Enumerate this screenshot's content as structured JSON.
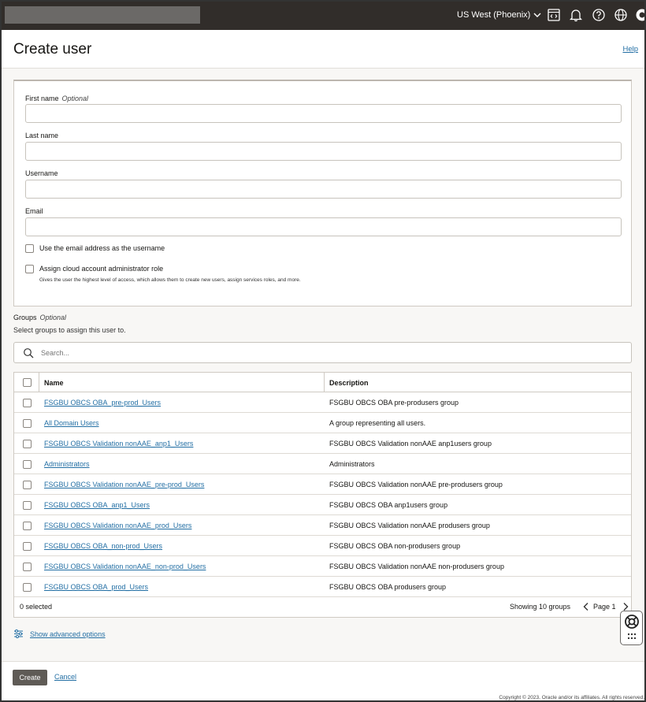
{
  "topbar": {
    "region": "US West (Phoenix)",
    "icons": [
      "code-editor-icon",
      "bell-icon",
      "help-icon",
      "globe-icon",
      "profile-icon"
    ]
  },
  "header": {
    "title": "Create user",
    "help": "Help"
  },
  "form": {
    "first_name_label": "First name",
    "first_name_optional": "Optional",
    "first_name_value": "",
    "last_name_label": "Last name",
    "last_name_value": "",
    "username_label": "Username",
    "username_value": "",
    "email_label": "Email",
    "email_value": "",
    "use_email_label": "Use the email address as the username",
    "use_email_checked": false,
    "admin_label": "Assign cloud account administrator role",
    "admin_help": "Gives the user the highest level of access, which allows them to create new users, assign services roles, and more.",
    "admin_checked": false
  },
  "groups": {
    "label": "Groups",
    "optional": "Optional",
    "help": "Select groups to assign this user to.",
    "search_placeholder": "Search...",
    "columns": {
      "name": "Name",
      "description": "Description"
    },
    "rows": [
      {
        "name": "FSGBU OBCS OBA_pre-prod_Users",
        "description": "FSGBU OBCS OBA pre-produsers group"
      },
      {
        "name": "All Domain Users",
        "description": "A group representing all users."
      },
      {
        "name": "FSGBU OBCS Validation nonAAE_anp1_Users",
        "description": "FSGBU OBCS Validation nonAAE anp1users group"
      },
      {
        "name": "Administrators",
        "description": "Administrators"
      },
      {
        "name": "FSGBU OBCS Validation nonAAE_pre-prod_Users",
        "description": "FSGBU OBCS Validation nonAAE pre-produsers group"
      },
      {
        "name": "FSGBU OBCS OBA_anp1_Users",
        "description": "FSGBU OBCS OBA anp1users group"
      },
      {
        "name": "FSGBU OBCS Validation nonAAE_prod_Users",
        "description": "FSGBU OBCS Validation nonAAE produsers group"
      },
      {
        "name": "FSGBU OBCS OBA_non-prod_Users",
        "description": "FSGBU OBCS OBA non-produsers group"
      },
      {
        "name": "FSGBU OBCS Validation nonAAE_non-prod_Users",
        "description": "FSGBU OBCS Validation nonAAE non-produsers group"
      },
      {
        "name": "FSGBU OBCS OBA_prod_Users",
        "description": "FSGBU OBCS OBA produsers group"
      }
    ],
    "selected_text": "0 selected",
    "showing_text": "Showing 10 groups",
    "page_text": "Page 1"
  },
  "advanced": {
    "label": "Show advanced options"
  },
  "footer": {
    "create": "Create",
    "cancel": "Cancel",
    "copyright": "Copyright © 2023, Oracle and/or its affiliates. All rights reserved."
  },
  "colors": {
    "topbar": "#312d2a",
    "link": "#236fa4",
    "primary_button": "#5f5b56"
  }
}
